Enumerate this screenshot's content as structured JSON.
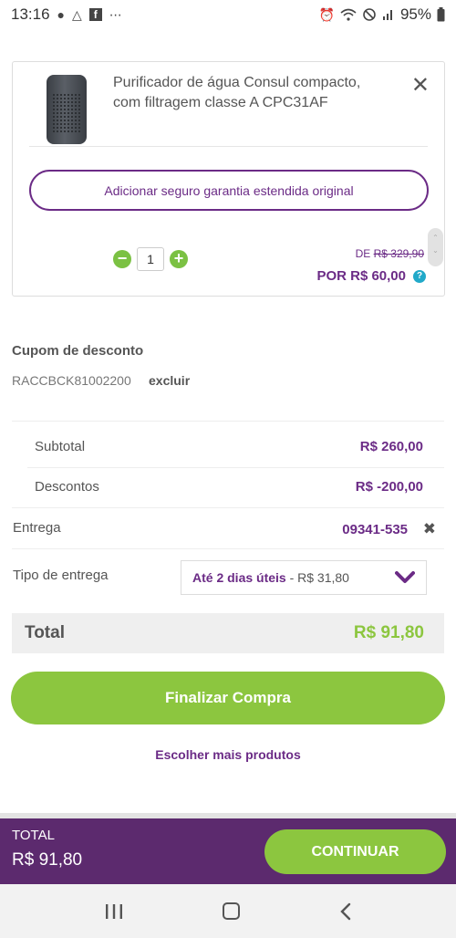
{
  "status_bar": {
    "time": "13:16",
    "battery": "95%"
  },
  "cart_item": {
    "name": "Purificador de água Consul compacto, com filtragem classe A CPC31AF",
    "warranty_label": "Adicionar seguro garantia estendida original",
    "quantity": "1",
    "minus_symbol": "−",
    "plus_symbol": "+",
    "price_from_prefix": "DE",
    "price_from": "R$ 329,90",
    "price_now": "POR R$ 60,00",
    "help_symbol": "?"
  },
  "coupon": {
    "title": "Cupom de desconto",
    "code": "RACCBCK81002200",
    "remove_label": "excluir"
  },
  "summary": {
    "subtotal_label": "Subtotal",
    "subtotal_value": "R$ 260,00",
    "discounts_label": "Descontos",
    "discounts_value": "R$ -200,00",
    "delivery_label": "Entrega",
    "delivery_value": "09341-535",
    "delivery_type_label": "Tipo de entrega",
    "delivery_option_bold": "Até 2 dias úteis",
    "delivery_option_rest": " - R$ 31,80"
  },
  "total": {
    "label": "Total",
    "value": "R$ 91,80"
  },
  "actions": {
    "finalize": "Finalizar Compra",
    "more_products": "Escolher mais produtos"
  },
  "bottom_bar": {
    "total_label": "TOTAL",
    "total_value": "R$ 91,80",
    "continue": "CONTINUAR"
  },
  "colors": {
    "brand_purple": "#6b2b86",
    "brand_green": "#8cc63f",
    "bottom_bar": "#5c2a6e"
  },
  "icons": [
    "alarm-icon",
    "wifi-icon",
    "no-signal-icon",
    "signal-icon",
    "battery-icon",
    "close-icon",
    "help-icon",
    "chevron-down-icon",
    "nav-recents-icon",
    "nav-home-icon",
    "nav-back-icon"
  ]
}
